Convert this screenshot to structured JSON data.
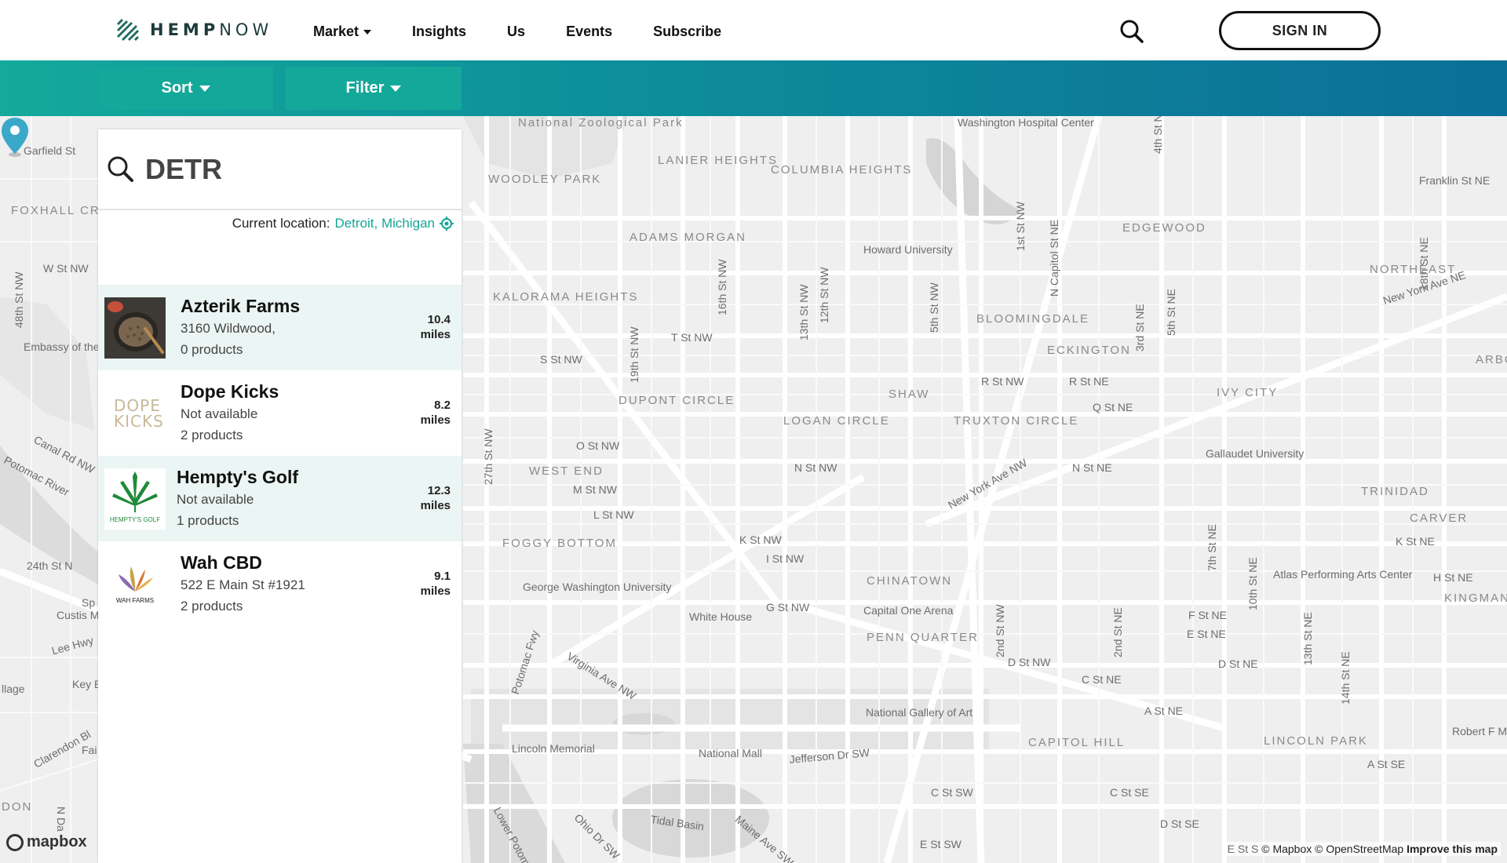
{
  "header": {
    "logo_text_bold": "HEMP",
    "logo_text_light": "NOW",
    "nav": [
      "Market",
      "Insights",
      "Us",
      "Events",
      "Subscribe"
    ],
    "signin_label": "SIGN IN"
  },
  "toolbar": {
    "sort_label": "Sort",
    "filter_label": "Filter"
  },
  "search": {
    "query": "DETR",
    "location_prefix": "Current location:",
    "location_city": "Detroit, Michigan"
  },
  "results": [
    {
      "name": "Azterik Farms",
      "address": "3160 Wildwood,",
      "products": "0 products",
      "distance": "10.4",
      "unit": "miles"
    },
    {
      "name": "Dope Kicks",
      "address": "Not available",
      "products": "2 products",
      "distance": "8.2",
      "unit": "miles",
      "logo_text": "DOPE KICKS"
    },
    {
      "name": "Hempty's Golf",
      "address": "Not available",
      "products": "1 products",
      "distance": "12.3",
      "unit": "miles",
      "logo_text": "HEMPTY'S GOLF"
    },
    {
      "name": "Wah CBD",
      "address": "522 E Main St #1921",
      "products": "2 products",
      "distance": "9.1",
      "unit": "miles",
      "logo_text": "WAH FARMS"
    }
  ],
  "map": {
    "labels": [
      "National Zoological Park",
      "Washington Hospital Center",
      "LANIER HEIGHTS",
      "COLUMBIA HEIGHTS",
      "WOODLEY PARK",
      "ADAMS MORGAN",
      "Howard University",
      "EDGEWOOD",
      "Franklin St NE",
      "Garfield St",
      "FOXHALL CRESCENT",
      "W St NW",
      "NORTHEAST",
      "New York Ave NE",
      "KALORAMA HEIGHTS",
      "BLOOMINGDALE",
      "T St NW",
      "ECKINGTON",
      "ARBOR",
      "Embassy of the Republic of C",
      "S St NW",
      "R St NW",
      "R St NE",
      "IVY CITY",
      "DUPONT CIRCLE",
      "SHAW",
      "Q St NE",
      "LOGAN CIRCLE",
      "TRUXTON CIRCLE",
      "Canal Rd NW",
      "O St NW",
      "Gallaudet University",
      "WEST END",
      "N St NW",
      "N St NE",
      "Potomac River",
      "M St NW",
      "New York Ave NW",
      "TRINIDAD",
      "L St NW",
      "K St NW",
      "FOGGY BOTTOM",
      "I St NW",
      "CARVER",
      "K St NE",
      "24th St N",
      "George Washington University",
      "CHINATOWN",
      "Atlas Performing Arts Center",
      "H St NE",
      "White House",
      "G St NW",
      "Capital One Arena",
      "F St NE",
      "E St NE",
      "KINGMAN PARK",
      "Lee Hwy",
      "PENN QUARTER",
      "D St NW",
      "D St NE",
      "Key B",
      "Virginia Ave NW",
      "C St NE",
      "National Gallery of Art",
      "A St NE",
      "Lincoln Memorial",
      "National Mall",
      "Jefferson Dr SW",
      "CAPITOL HILL",
      "LINCOLN PARK",
      "A St SE",
      "Robert F Memoria",
      "Tidal Basin",
      "C St SW",
      "C St SE",
      "Maine Ave SW",
      "Ohio Dr SW",
      "D St SE",
      "E St SW",
      "DON",
      "16th St NW",
      "13th St NW",
      "12th St NW",
      "1st St NW",
      "N Capitol St NE",
      "4th St NE",
      "19th St NW",
      "5th St NW",
      "3rd St NE",
      "5th St NE",
      "2nd St NW",
      "2nd St NE",
      "7th St NE",
      "10th St NE",
      "13th St NE",
      "14th St NE",
      "27th St NW",
      "Potomac Fwy",
      "48th St NW",
      "Clarendon Bl",
      "Custis M",
      "Lower Potomac River",
      "18th St NE",
      "llage",
      "Sp",
      "Fai",
      "N Da"
    ],
    "attribution_prefix": "E St S",
    "attribution_mapbox": "© Mapbox",
    "attribution_osm": "© OpenStreetMap",
    "attribution_improve": "Improve this map",
    "logo_text": "mapbox"
  },
  "colors": {
    "accent": "#16a596",
    "toolbar_start": "#14a99b",
    "toolbar_end": "#0b6f98",
    "pin": "#3aa8c9",
    "selected_row": "#ebf5f3"
  },
  "icons": [
    "hempnow-logo-icon",
    "search-icon",
    "caret-down-icon",
    "crosshair-location-icon",
    "map-pin-icon",
    "mapbox-logo-icon"
  ]
}
